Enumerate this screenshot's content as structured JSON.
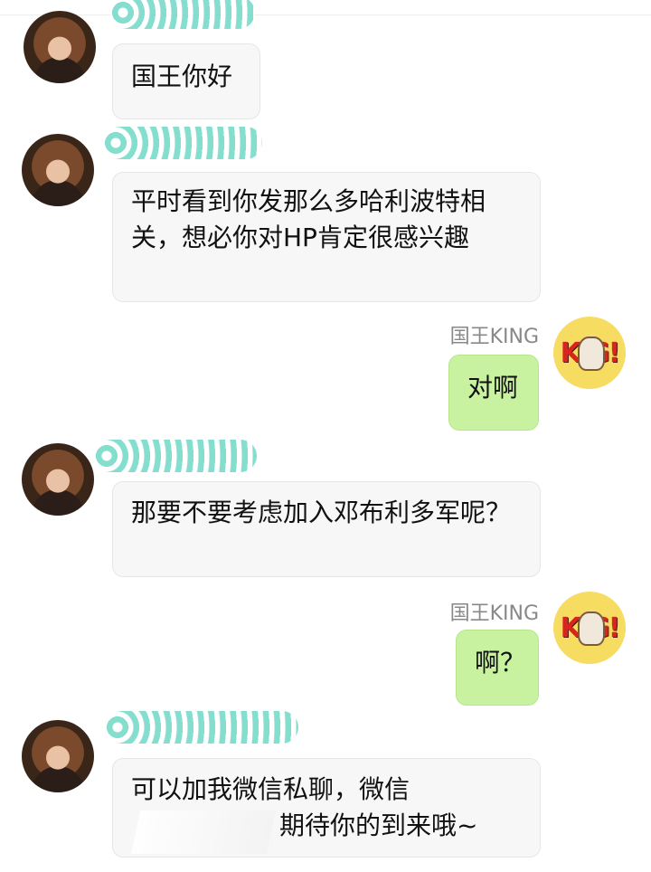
{
  "chat": {
    "messages": [
      {
        "from": "other",
        "text": "国王你好"
      },
      {
        "from": "other",
        "text": "平时看到你发那么多哈利波特相关，想必你对HP肯定很感兴趣"
      },
      {
        "from": "me",
        "sender": "国王KING",
        "text": "对啊"
      },
      {
        "from": "other",
        "text": "那要不要考虑加入邓布利多军呢？"
      },
      {
        "from": "me",
        "sender": "国王KING",
        "text": "啊？"
      },
      {
        "from": "other",
        "line1": "可以加我微信私聊，微信",
        "line2": "期待你的到来哦~"
      }
    ],
    "king_avatar_text": "KIG!"
  }
}
